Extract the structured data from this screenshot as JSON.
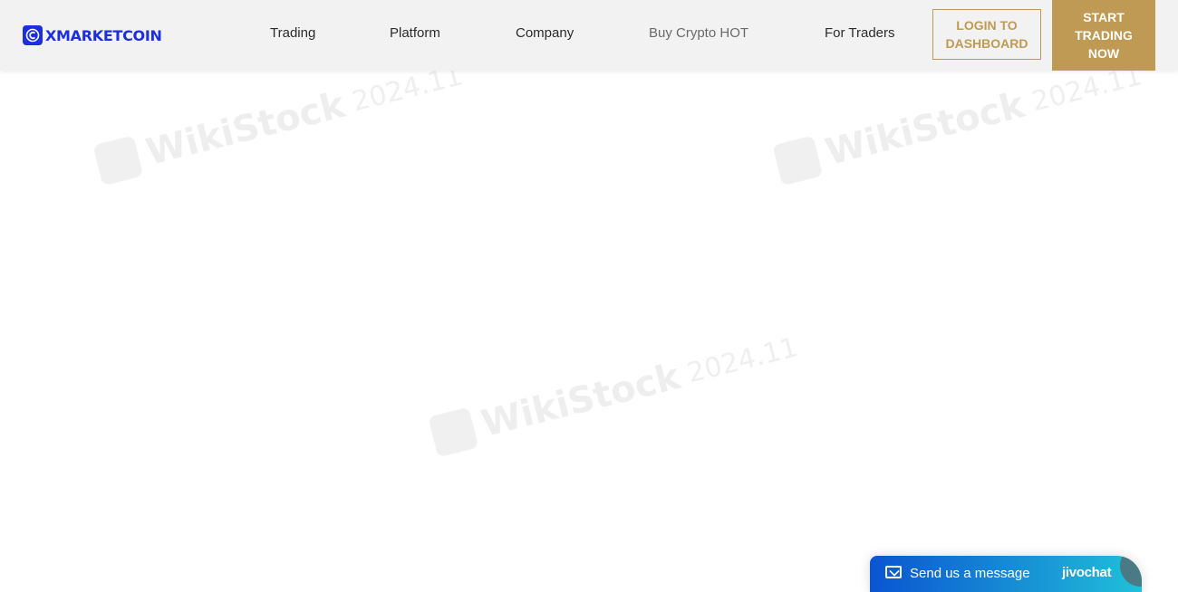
{
  "header": {
    "brand": "XMARKETCOIN",
    "nav": [
      {
        "label": "Trading"
      },
      {
        "label": "Platform"
      },
      {
        "label": "Company"
      },
      {
        "label": "Buy Crypto HOT"
      },
      {
        "label": "For Traders"
      }
    ],
    "login_label": "LOGIN TO\nDASHBOARD",
    "start_label": "START\nTRADING\nNOW"
  },
  "watermark": {
    "word": "WikiStock",
    "date": "2024.11"
  },
  "chat": {
    "label": "Send us a message",
    "brand": "jivochat"
  },
  "colors": {
    "brand_blue": "#1b2fe0",
    "gold": "#bf9a55"
  }
}
